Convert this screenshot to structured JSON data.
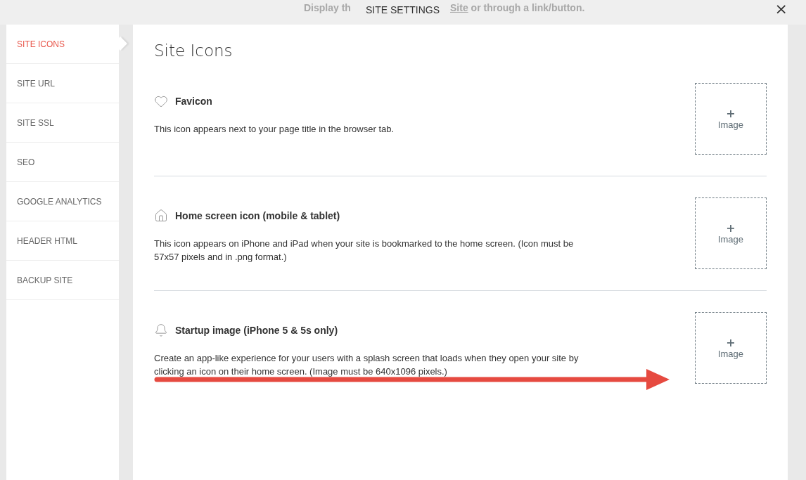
{
  "background_text": {
    "before": "Display th",
    "link": "Site",
    "after": "or through a link/button."
  },
  "dialog": {
    "title": "SITE SETTINGS",
    "close": "×"
  },
  "sidebar": {
    "items": [
      {
        "label": "SITE ICONS",
        "selected": true
      },
      {
        "label": "SITE URL",
        "selected": false
      },
      {
        "label": "SITE SSL",
        "selected": false
      },
      {
        "label": "SEO",
        "selected": false
      },
      {
        "label": "GOOGLE ANALYTICS",
        "selected": false
      },
      {
        "label": "HEADER HTML",
        "selected": false
      },
      {
        "label": "BACKUP SITE",
        "selected": false
      }
    ]
  },
  "page_title": "Site Icons",
  "sections": [
    {
      "kind": "heart",
      "title": "Favicon",
      "description": "This icon appears next to your page title in the browser tab.",
      "upload": {
        "plus": "+",
        "label": "Image"
      }
    },
    {
      "kind": "home",
      "title": "Home screen icon (mobile & tablet)",
      "description": "This icon appears on iPhone and iPad when your site is bookmarked to the home screen. (Icon must be 57x57 pixels and in .png format.)",
      "upload": {
        "plus": "+",
        "label": "Image"
      }
    },
    {
      "kind": "bell",
      "title": "Startup image (iPhone 5 & 5s only)",
      "description": "Create an app-like experience for your users with a splash screen that loads when they open your site by clicking an icon on their home screen. (Image must be 640x1096 pixels.)",
      "upload": {
        "plus": "+",
        "label": "Image"
      }
    }
  ]
}
